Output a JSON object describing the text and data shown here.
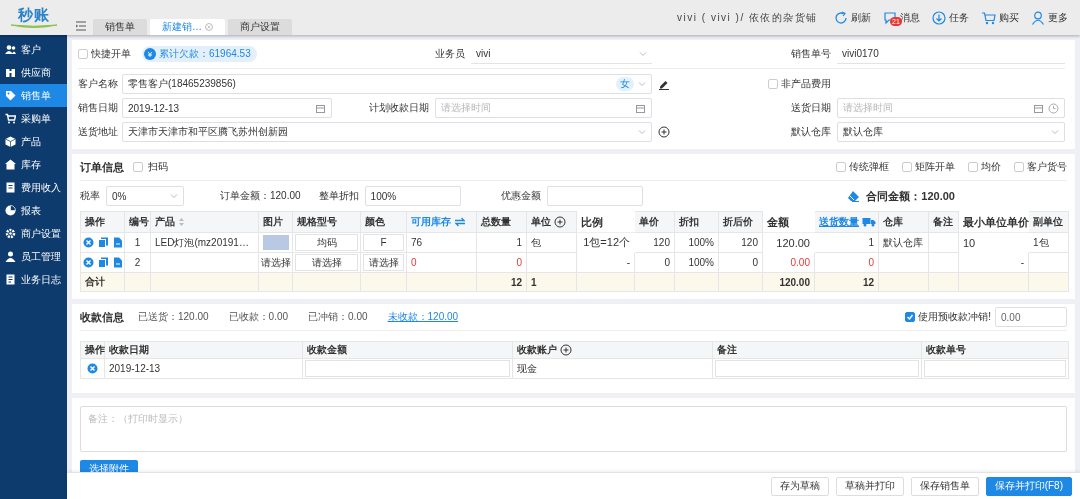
{
  "topbar": {
    "logo": "秒账",
    "tabs": [
      {
        "label": "销售单",
        "selected": false,
        "closable": false
      },
      {
        "label": "新建销…",
        "selected": true,
        "closable": true
      },
      {
        "label": "商户设置",
        "selected": false,
        "closable": false
      }
    ],
    "user": "vivi ( vivi )/ 依依的杂货铺",
    "actions": [
      {
        "label": "刷新"
      },
      {
        "label": "消息",
        "badge": "21"
      },
      {
        "label": "任务"
      },
      {
        "label": "购买"
      },
      {
        "label": "更多"
      }
    ]
  },
  "sidebar": {
    "items": [
      {
        "label": "客户",
        "selected": false
      },
      {
        "label": "供应商",
        "selected": false
      },
      {
        "label": "销售单",
        "selected": true
      },
      {
        "label": "采购单",
        "selected": false
      },
      {
        "label": "产品",
        "selected": false
      },
      {
        "label": "库存",
        "selected": false
      },
      {
        "label": "费用收入",
        "selected": false
      },
      {
        "label": "报表",
        "selected": false
      },
      {
        "label": "商户设置",
        "selected": false
      },
      {
        "label": "员工管理",
        "selected": false
      },
      {
        "label": "业务日志",
        "selected": false
      }
    ]
  },
  "form": {
    "quick_order": {
      "label": "快捷开单",
      "checked": false
    },
    "debt": {
      "symbol": "¥",
      "text": "累计欠款：61964.53"
    },
    "salesperson": {
      "label": "业务员",
      "value": "vivi"
    },
    "order_no": {
      "label": "销售单号",
      "value": "vivi0170"
    },
    "customer": {
      "label": "客户名称",
      "value": "零售客户(18465239856)",
      "tag": "女"
    },
    "non_product_fee": {
      "label": "非产品费用",
      "checked": false
    },
    "sale_date": {
      "label": "销售日期",
      "value": "2019-12-13"
    },
    "planned_payment_date": {
      "label": "计划收款日期",
      "placeholder": "请选择时间"
    },
    "delivery_date": {
      "label": "送货日期",
      "placeholder": "请选择时间"
    },
    "delivery_address": {
      "label": "送货地址",
      "value": "天津市天津市和平区腾飞苏州创新园"
    },
    "default_warehouse": {
      "label": "默认仓库",
      "value": "默认仓库"
    }
  },
  "order": {
    "title": "订单信息",
    "scan": {
      "label": "扫码",
      "checked": false
    },
    "options": [
      {
        "label": "传统弹框",
        "checked": false
      },
      {
        "label": "矩阵开单",
        "checked": false
      },
      {
        "label": "均价",
        "checked": false
      },
      {
        "label": "客户货号",
        "checked": false
      }
    ],
    "tax": {
      "label": "税率",
      "value": "0%"
    },
    "order_amount": "订单金额：120.00",
    "discount": {
      "label": "整单折扣",
      "value": "100%"
    },
    "coupon": {
      "label": "优惠金额"
    },
    "contract_amount": "合同金额：120.00",
    "columns": [
      {
        "label": "操作",
        "kind": "plain"
      },
      {
        "label": "编号",
        "kind": "plain"
      },
      {
        "label": "产品",
        "kind": "sortable"
      },
      {
        "label": "图片",
        "kind": "plain"
      },
      {
        "label": "规格型号",
        "kind": "plain"
      },
      {
        "label": "颜色",
        "kind": "plain"
      },
      {
        "label": "可用库存",
        "kind": "switch"
      },
      {
        "label": "总数量",
        "kind": "plain"
      },
      {
        "label": "单位",
        "kind": "addable"
      },
      {
        "label": "比例",
        "kind": "floating"
      },
      {
        "label": "单价",
        "kind": "plain"
      },
      {
        "label": "折扣",
        "kind": "plain"
      },
      {
        "label": "折后价",
        "kind": "plain"
      },
      {
        "label": "金额",
        "kind": "floating"
      },
      {
        "label": "送货数量",
        "kind": "delivery"
      },
      {
        "label": "仓库",
        "kind": "plain"
      },
      {
        "label": "备注",
        "kind": "plain"
      },
      {
        "label": "最小单位单价",
        "kind": "floating"
      },
      {
        "label": "副单位",
        "kind": "plain"
      }
    ],
    "rows": [
      {
        "kind": "item",
        "cells": [
          {
            "kind": "actions"
          },
          {
            "kind": "index",
            "text": "1"
          },
          {
            "kind": "text",
            "text": "LED灯泡(mz20191…"
          },
          {
            "kind": "image"
          },
          {
            "kind": "input",
            "text": "均码"
          },
          {
            "kind": "input",
            "text": "F"
          },
          {
            "kind": "text",
            "text": "76"
          },
          {
            "kind": "number",
            "text": "1"
          },
          {
            "kind": "text",
            "text": "包"
          },
          {
            "kind": "number",
            "text": "1包=12个"
          },
          {
            "kind": "number",
            "text": "120"
          },
          {
            "kind": "number",
            "text": "100%"
          },
          {
            "kind": "number",
            "text": "120"
          },
          {
            "kind": "number",
            "text": "120.00"
          },
          {
            "kind": "number",
            "text": "1"
          },
          {
            "kind": "text",
            "text": "默认仓库"
          },
          {
            "kind": "text"
          },
          {
            "kind": "text",
            "text": "10"
          },
          {
            "kind": "text",
            "text": "1包"
          }
        ]
      },
      {
        "kind": "item",
        "cells": [
          {
            "kind": "actions"
          },
          {
            "kind": "index",
            "text": "2"
          },
          {
            "kind": "text"
          },
          {
            "kind": "picker",
            "text": "请选择"
          },
          {
            "kind": "input",
            "text": "请选择"
          },
          {
            "kind": "input",
            "text": "请选择"
          },
          {
            "kind": "alert",
            "text": "0"
          },
          {
            "kind": "alertnumber",
            "text": "0"
          },
          {
            "kind": "text"
          },
          {
            "kind": "number",
            "text": "-"
          },
          {
            "kind": "number",
            "text": "0"
          },
          {
            "kind": "number",
            "text": "100%"
          },
          {
            "kind": "number",
            "text": "0"
          },
          {
            "kind": "alertnumber",
            "text": "0.00"
          },
          {
            "kind": "alertnumber",
            "text": "0"
          },
          {
            "kind": "text"
          },
          {
            "kind": "text"
          },
          {
            "kind": "number",
            "text": "-"
          },
          {
            "kind": "text"
          }
        ]
      },
      {
        "kind": "total",
        "cells": [
          {
            "kind": "text",
            "text": "合计"
          },
          {
            "kind": "text"
          },
          {
            "kind": "text"
          },
          {
            "kind": "text"
          },
          {
            "kind": "text"
          },
          {
            "kind": "text"
          },
          {
            "kind": "text"
          },
          {
            "kind": "number",
            "text": "12"
          },
          {
            "kind": "text",
            "text": "1"
          },
          {
            "kind": "text"
          },
          {
            "kind": "text"
          },
          {
            "kind": "text"
          },
          {
            "kind": "text"
          },
          {
            "kind": "number",
            "text": "120.00"
          },
          {
            "kind": "number",
            "text": "12"
          },
          {
            "kind": "text"
          },
          {
            "kind": "text"
          },
          {
            "kind": "text"
          },
          {
            "kind": "text"
          }
        ]
      }
    ]
  },
  "payment": {
    "title": "收款信息",
    "stats": [
      {
        "text": "已送货：120.00",
        "kind": "plain"
      },
      {
        "text": "已收款：0.00",
        "kind": "plain"
      },
      {
        "text": "已冲销：0.00",
        "kind": "plain"
      },
      {
        "text": "未收款：120.00",
        "kind": "link"
      }
    ],
    "prepay": {
      "label": "使用预收款冲销!",
      "checked": true,
      "value": "0.00"
    },
    "columns": [
      {
        "label": "操作",
        "kind": "plain"
      },
      {
        "label": "收款日期",
        "kind": "plain"
      },
      {
        "label": "收款金额",
        "kind": "plain"
      },
      {
        "label": "收款账户",
        "kind": "addable"
      },
      {
        "label": "备注",
        "kind": "plain"
      },
      {
        "label": "收款单号",
        "kind": "plain"
      }
    ],
    "rows": [
      {
        "cells": [
          {
            "kind": "delete"
          },
          {
            "kind": "text",
            "text": "2019-12-13"
          },
          {
            "kind": "input"
          },
          {
            "kind": "text",
            "text": "现金"
          },
          {
            "kind": "input"
          },
          {
            "kind": "input"
          }
        ]
      }
    ]
  },
  "notes": {
    "placeholder": "备注：（打印时显示）",
    "attach_button": "选择附件"
  },
  "footer": {
    "buttons": [
      {
        "label": "存为草稿",
        "kind": "default"
      },
      {
        "label": "草稿并打印",
        "kind": "default"
      },
      {
        "label": "保存销售单",
        "kind": "default"
      },
      {
        "label": "保存并打印(F8)",
        "kind": "primary"
      }
    ]
  }
}
